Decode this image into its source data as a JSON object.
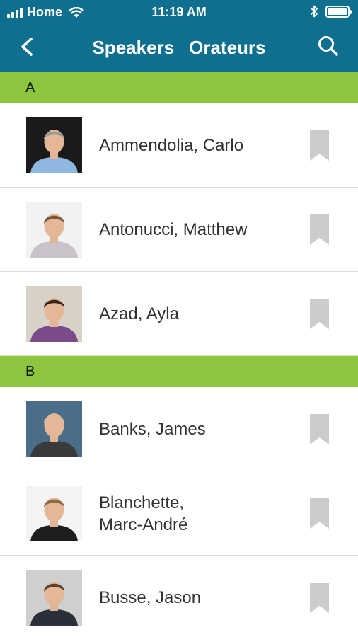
{
  "status_bar": {
    "carrier": "Home",
    "time": "11:19 AM",
    "icons": [
      "signal-bars-icon",
      "wifi-icon",
      "bluetooth-icon",
      "battery-icon"
    ]
  },
  "nav": {
    "title_en": "Speakers",
    "title_fr": "Orateurs",
    "back_icon": "chevron-left-icon",
    "search_icon": "search-icon"
  },
  "colors": {
    "nav_bar": "#0e6f8f",
    "section_header": "#8cc63f",
    "bookmark": "#cccccc"
  },
  "sections": [
    {
      "letter": "A",
      "speakers": [
        {
          "name": "Ammendolia, Carlo",
          "photo": "speaker-photo",
          "bookmarked": false
        },
        {
          "name": "Antonucci, Matthew",
          "photo": "speaker-photo",
          "bookmarked": false
        },
        {
          "name": "Azad, Ayla",
          "photo": "speaker-photo",
          "bookmarked": false
        }
      ]
    },
    {
      "letter": "B",
      "speakers": [
        {
          "name": "Banks, James",
          "photo": "speaker-photo",
          "bookmarked": false
        },
        {
          "name": "Blanchette, Marc-André",
          "photo": "speaker-photo",
          "bookmarked": false
        },
        {
          "name": "Busse, Jason",
          "photo": "speaker-photo",
          "bookmarked": false
        }
      ]
    }
  ]
}
